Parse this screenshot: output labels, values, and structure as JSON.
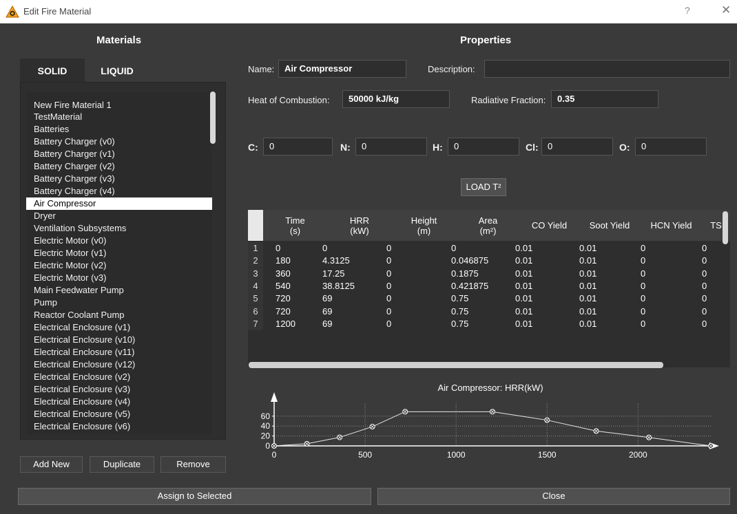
{
  "window": {
    "title": "Edit Fire Material",
    "help_glyph": "?",
    "close_glyph": "✕"
  },
  "materials": {
    "heading": "Materials",
    "tabs": [
      "SOLID",
      "LIQUID"
    ],
    "items": [
      "New Fire Material 1",
      "TestMaterial",
      "Batteries",
      "Battery Charger (v0)",
      "Battery Charger (v1)",
      "Battery Charger (v2)",
      "Battery Charger (v3)",
      "Battery Charger (v4)",
      "Air Compressor",
      "Dryer",
      "Ventilation Subsystems",
      "Electric Motor (v0)",
      "Electric Motor (v1)",
      "Electric Motor (v2)",
      "Electric Motor (v3)",
      "Main Feedwater Pump",
      "Pump",
      "Reactor Coolant Pump",
      "Electrical Enclosure (v1)",
      "Electrical Enclosure (v10)",
      "Electrical Enclosure (v11)",
      "Electrical Enclosure (v12)",
      "Electrical Enclosure (v2)",
      "Electrical Enclosure (v3)",
      "Electrical Enclosure (v4)",
      "Electrical Enclosure (v5)",
      "Electrical Enclosure (v6)"
    ],
    "selected_index": 8,
    "buttons": {
      "add_new": "Add New",
      "duplicate": "Duplicate",
      "remove": "Remove"
    }
  },
  "properties": {
    "heading": "Properties",
    "name_label": "Name:",
    "name_value": "Air Compressor",
    "description_label": "Description:",
    "description_value": "",
    "heat_label": "Heat of Combustion:",
    "heat_value": "50000 kJ/kg",
    "radiative_label": "Radiative Fraction:",
    "radiative_value": "0.35",
    "elements": [
      {
        "label": "C:",
        "value": "0"
      },
      {
        "label": "N:",
        "value": "0"
      },
      {
        "label": "H:",
        "value": "0"
      },
      {
        "label": "Cl:",
        "value": "0"
      },
      {
        "label": "O:",
        "value": "0"
      }
    ],
    "load_button": "LOAD T²"
  },
  "table": {
    "columns": [
      [
        "Time",
        "(s)"
      ],
      [
        "HRR",
        "(kW)"
      ],
      [
        "Height",
        "(m)"
      ],
      [
        "Area",
        "(m²)"
      ],
      [
        "CO Yield",
        ""
      ],
      [
        "Soot Yield",
        ""
      ],
      [
        "HCN Yield",
        ""
      ],
      [
        "TS",
        ""
      ]
    ],
    "rows": [
      [
        "1",
        "0",
        "0",
        "0",
        "0",
        "0.01",
        "0.01",
        "0",
        "0"
      ],
      [
        "2",
        "180",
        "4.3125",
        "0",
        "0.046875",
        "0.01",
        "0.01",
        "0",
        "0"
      ],
      [
        "3",
        "360",
        "17.25",
        "0",
        "0.1875",
        "0.01",
        "0.01",
        "0",
        "0"
      ],
      [
        "4",
        "540",
        "38.8125",
        "0",
        "0.421875",
        "0.01",
        "0.01",
        "0",
        "0"
      ],
      [
        "5",
        "720",
        "69",
        "0",
        "0.75",
        "0.01",
        "0.01",
        "0",
        "0"
      ],
      [
        "6",
        "720",
        "69",
        "0",
        "0.75",
        "0.01",
        "0.01",
        "0",
        "0"
      ],
      [
        "7",
        "1200",
        "69",
        "0",
        "0.75",
        "0.01",
        "0.01",
        "0",
        "0"
      ]
    ]
  },
  "chart_data": {
    "type": "line",
    "title": "Air Compressor: HRR(kW)",
    "xlabel": "",
    "ylabel": "",
    "x": [
      0,
      180,
      360,
      540,
      720,
      1200,
      1500,
      1770,
      2060,
      2400
    ],
    "values": [
      0,
      4.3125,
      17.25,
      38.8125,
      69,
      69,
      52,
      30,
      17,
      0
    ],
    "xlim": [
      0,
      2400
    ],
    "ylim": [
      0,
      75
    ],
    "xticks": [
      0,
      500,
      1000,
      1500,
      2000
    ],
    "yticks": [
      0,
      20,
      40,
      60
    ],
    "grid": true
  },
  "footer": {
    "assign": "Assign to Selected",
    "close": "Close"
  }
}
